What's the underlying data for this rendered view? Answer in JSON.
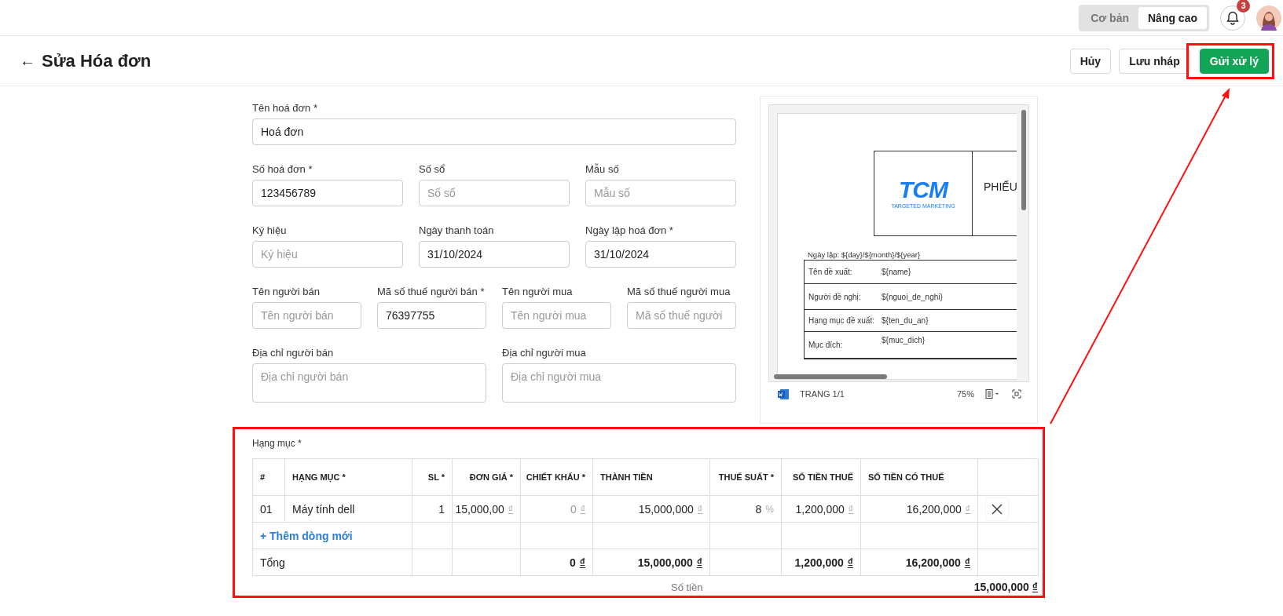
{
  "topbar": {
    "mode_toggle": [
      {
        "label": "Cơ bản",
        "selected": false
      },
      {
        "label": "Nâng cao",
        "selected": true
      }
    ],
    "notifications": {
      "count": "3"
    }
  },
  "header": {
    "title": "Sửa Hóa đơn",
    "back": "←",
    "buttons": [
      {
        "label": "Hủy",
        "kind": "default",
        "highlight": false
      },
      {
        "label": "Lưu nháp",
        "kind": "default",
        "highlight": false
      },
      {
        "label": "Gửi xử lý",
        "kind": "primary",
        "highlight": true
      }
    ]
  },
  "form": {
    "rows": [
      [
        {
          "label": "Tên hoá đơn *",
          "value": "Hoá đơn",
          "kind": "input"
        }
      ],
      [
        {
          "label": "Số hoá đơn *",
          "value": "123456789",
          "kind": "input"
        },
        {
          "label": "Số sổ",
          "placeholder": "Số sổ",
          "kind": "input"
        },
        {
          "label": "Mẫu số",
          "placeholder": "Mẫu số",
          "kind": "input"
        }
      ],
      [
        {
          "label": "Ký hiệu",
          "placeholder": "Ký hiệu",
          "kind": "input"
        },
        {
          "label": "Ngày thanh toán",
          "value": "31/10/2024",
          "kind": "input"
        },
        {
          "label": "Ngày lập hoá đơn *",
          "value": "31/10/2024",
          "kind": "input"
        }
      ],
      [
        {
          "label": "Tên người bán",
          "placeholder": "Tên người bán",
          "kind": "input"
        },
        {
          "label": "Mã số thuế người bán *",
          "value": "76397755",
          "kind": "input"
        },
        {
          "label": "Tên người mua",
          "placeholder": "Tên người mua",
          "kind": "input"
        },
        {
          "label": "Mã số thuế người mua",
          "placeholder": "Mã số thuế người",
          "kind": "input"
        }
      ],
      [
        {
          "label": "Địa chỉ người bán",
          "placeholder": "Địa chỉ người bán",
          "kind": "textarea"
        },
        {
          "label": "Địa chỉ người mua",
          "placeholder": "Địa chỉ người mua",
          "kind": "textarea"
        }
      ]
    ]
  },
  "preview": {
    "logo": "TCM",
    "logo_tagline": "TARGETED MARKETING",
    "heading": "PHIẾU",
    "date_line": "Ngày lập: ${day}/${month}/${year}",
    "rows": [
      {
        "label": "Tên đề xuất:",
        "value": "${name}"
      },
      {
        "label": "Người đề nghị:",
        "value": "${nguoi_de_nghi}"
      },
      {
        "label": "Hạng mục đề xuất:",
        "value": "${ten_du_an}"
      },
      {
        "label": "Mục đích:",
        "value": "${muc_dich}"
      }
    ],
    "footer": {
      "page": "TRANG 1/1",
      "zoom": "75%"
    }
  },
  "items": {
    "label": "Hạng mục *",
    "highlight": true,
    "columns": [
      "#",
      "HẠNG MỤC *",
      "SL *",
      "ĐƠN GIÁ *",
      "CHIẾT KHẤU *",
      "THÀNH TIỀN",
      "THUẾ SUẤT *",
      "SỐ TIỀN THUẾ",
      "SỐ TIỀN CÓ THUẾ"
    ],
    "rows": [
      {
        "index": "01",
        "name": "Máy tính dell",
        "quantity": "1",
        "amounts": [
          {
            "value": "15,000,00",
            "unit": "₫",
            "muted": false
          },
          {
            "value": "0",
            "unit": "₫",
            "muted": true
          },
          {
            "value": "15,000,000",
            "unit": "₫",
            "muted": false
          },
          {
            "value": "8",
            "unit": "%",
            "muted": false
          },
          {
            "value": "1,200,000",
            "unit": "₫",
            "muted": false
          },
          {
            "value": "16,200,000",
            "unit": "₫",
            "muted": false
          }
        ]
      }
    ],
    "add_row": "+ Thêm dòng mới",
    "total": {
      "label": "Tổng",
      "amounts": [
        {
          "kind": "blank"
        },
        {
          "kind": "amount",
          "value": "0",
          "unit": "₫"
        },
        {
          "kind": "amount",
          "value": "15,000,000",
          "unit": "₫"
        },
        {
          "kind": "blank"
        },
        {
          "kind": "amount",
          "value": "1,200,000",
          "unit": "₫"
        },
        {
          "kind": "amount",
          "value": "16,200,000",
          "unit": "₫"
        }
      ]
    },
    "summary": {
      "label": "Số tiền",
      "value": "15,000,000",
      "unit": "₫"
    }
  }
}
